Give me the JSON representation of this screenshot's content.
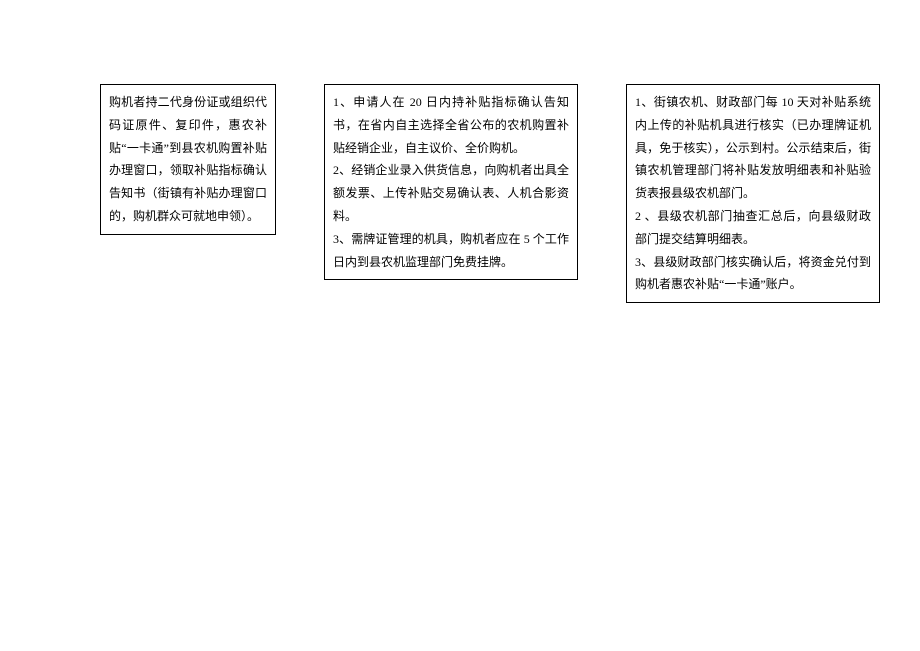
{
  "boxes": {
    "box1": {
      "text": "购机者持二代身份证或组织代码证原件、复印件，惠农补贴“一卡通”到县农机购置补贴办理窗口，领取补贴指标确认告知书（街镇有补贴办理窗口的，购机群众可就地申领）。"
    },
    "box2": {
      "line1": "1、申请人在 20 日内持补贴指标确认告知书，在省内自主选择全省公布的农机购置补贴经销企业，自主议价、全价购机。",
      "line2": "2、经销企业录入供货信息，向购机者出具全额发票、上传补贴交易确认表、人机合影资料。",
      "line3": "3、需牌证管理的机具，购机者应在 5 个工作日内到县农机监理部门免费挂牌。"
    },
    "box3": {
      "line1": "1、街镇农机、财政部门每 10 天对补贴系统内上传的补贴机具进行核实（已办理牌证机具，免于核实），公示到村。公示结束后，街镇农机管理部门将补贴发放明细表和补贴验货表报县级农机部门。",
      "line2": "2 、县级农机部门抽查汇总后，向县级财政部门提交结算明细表。",
      "line3": "3、县级财政部门核实确认后，将资金兑付到购机者惠农补贴“一卡通”账户。"
    }
  }
}
